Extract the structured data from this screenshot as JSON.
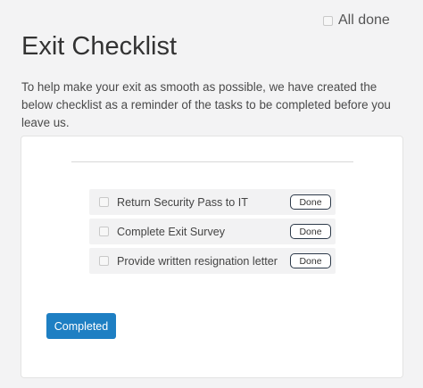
{
  "header": {
    "all_done_label": "All done",
    "title": "Exit Checklist",
    "intro": "To help make your exit as smooth as possible, we have created the below checklist as a reminder of the tasks to be completed before you leave us."
  },
  "tasks": [
    {
      "label": "Return Security Pass to IT",
      "button": "Done"
    },
    {
      "label": "Complete Exit Survey",
      "button": "Done"
    },
    {
      "label": "Provide written resignation letter",
      "button": "Done"
    }
  ],
  "actions": {
    "completed_label": "Completed"
  },
  "colors": {
    "primary": "#1e7fc3",
    "background": "#f3f3f4"
  }
}
